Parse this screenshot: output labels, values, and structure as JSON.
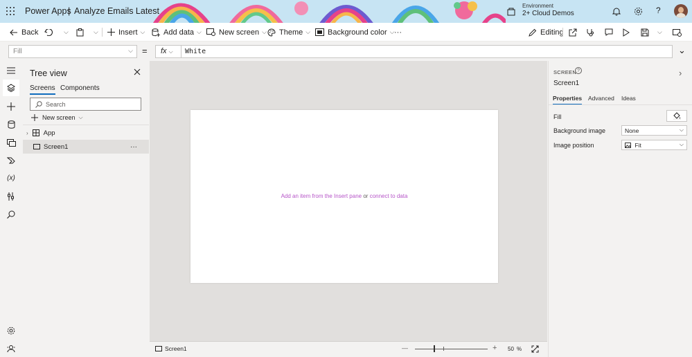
{
  "header": {
    "app_name": "Power Apps",
    "separator": "|",
    "app_title": "Analyze Emails Latest",
    "env_label": "Environment",
    "env_name": "2+ Cloud Demos"
  },
  "commandbar": {
    "back": "Back",
    "insert": "Insert",
    "add_data": "Add data",
    "new_screen": "New screen",
    "theme": "Theme",
    "background_color": "Background color",
    "more": "···",
    "editing": "Editing"
  },
  "formula_bar": {
    "property": "Fill",
    "equals": "=",
    "fx": "fx",
    "value": "White"
  },
  "tree_view": {
    "title": "Tree view",
    "tabs": [
      "Screens",
      "Components"
    ],
    "search_placeholder": "Search",
    "new_screen": "New screen",
    "items": [
      {
        "label": "App"
      },
      {
        "label": "Screen1"
      }
    ],
    "more": "···"
  },
  "canvas": {
    "hint_link1": "Add an item from the Insert pane",
    "hint_or": "or",
    "hint_link2": "connect to data"
  },
  "status_bar": {
    "screen_name": "Screen1",
    "minus": "—",
    "plus": "+",
    "zoom_value": "50",
    "zoom_unit": "%"
  },
  "properties_panel": {
    "type_label": "SCREEN",
    "screen_name": "Screen1",
    "tabs": [
      "Properties",
      "Advanced",
      "Ideas"
    ],
    "fill_label": "Fill",
    "bg_image_label": "Background image",
    "bg_image_value": "None",
    "image_position_label": "Image position",
    "image_position_value": "Fit"
  },
  "colors": {
    "accent": "#0f6cbd",
    "hint_link": "#b654c8",
    "header_bg": "#c7e4f3"
  }
}
